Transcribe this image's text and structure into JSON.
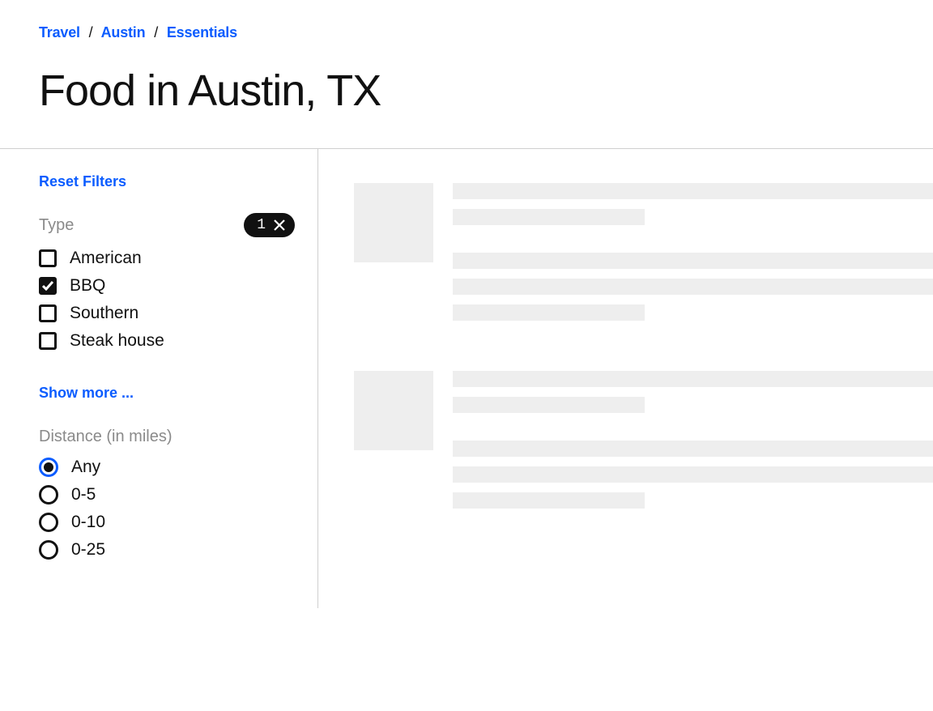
{
  "breadcrumb": {
    "items": [
      "Travel",
      "Austin",
      "Essentials"
    ],
    "separator": "/"
  },
  "page_title": "Food in Austin, TX",
  "sidebar": {
    "reset_label": "Reset Filters",
    "type_filter": {
      "heading": "Type",
      "active_count": "1",
      "options": [
        {
          "label": "American",
          "checked": false
        },
        {
          "label": "BBQ",
          "checked": true
        },
        {
          "label": "Southern",
          "checked": false
        },
        {
          "label": "Steak house",
          "checked": false
        }
      ]
    },
    "show_more_label": "Show more ...",
    "distance_filter": {
      "heading": "Distance (in miles)",
      "options": [
        {
          "label": "Any",
          "selected": true
        },
        {
          "label": "0-5",
          "selected": false
        },
        {
          "label": "0-10",
          "selected": false
        },
        {
          "label": "0-25",
          "selected": false
        }
      ]
    }
  }
}
